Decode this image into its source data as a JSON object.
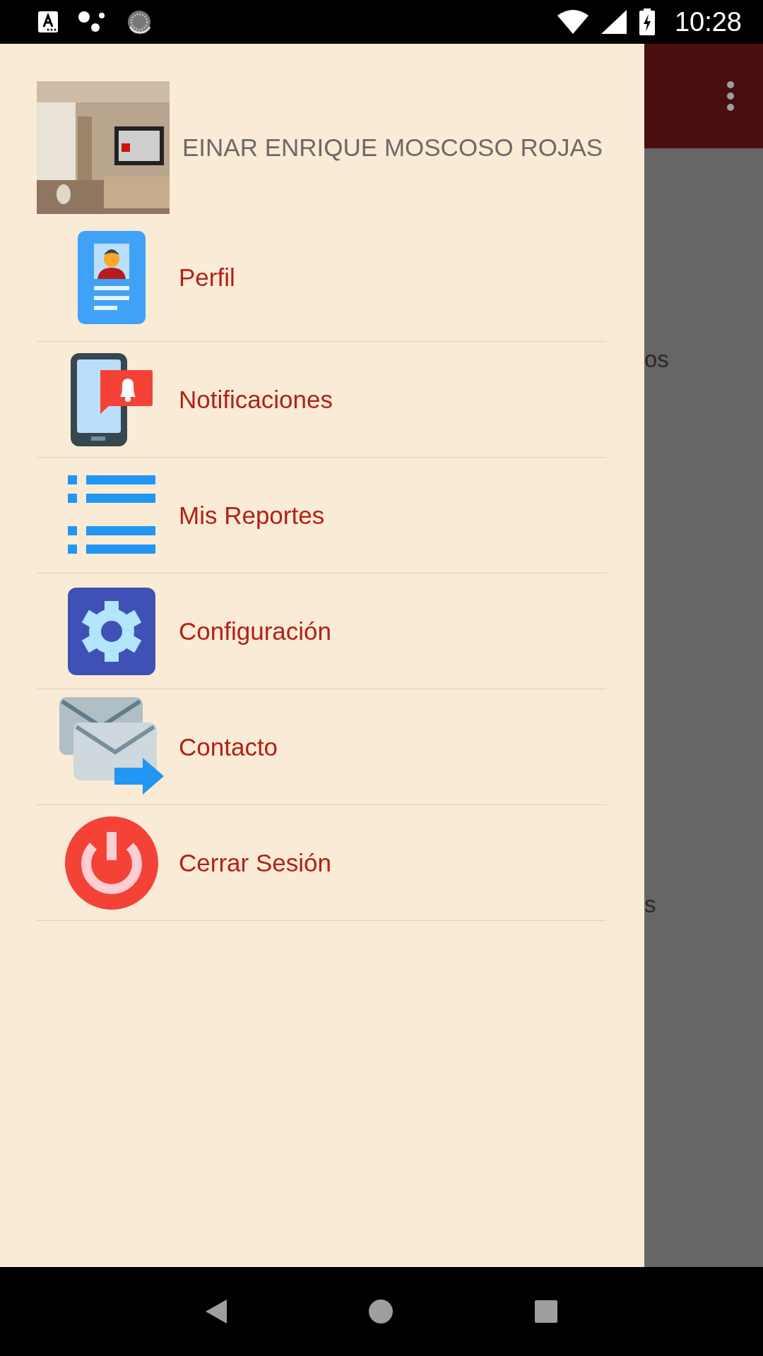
{
  "status_bar": {
    "time": "10:28"
  },
  "drawer": {
    "user_name": "EINAR ENRIQUE MOSCOSO ROJAS",
    "items": [
      {
        "kind": "profile",
        "label": "Perfil"
      },
      {
        "kind": "notifications",
        "label": "Notificaciones"
      },
      {
        "kind": "list",
        "label": "Mis Reportes"
      },
      {
        "kind": "settings",
        "label": "Configuración"
      },
      {
        "kind": "mail",
        "label": "Contacto"
      },
      {
        "kind": "power",
        "label": "Cerrar Sesión"
      }
    ]
  },
  "background": {
    "texts": [
      "os",
      "s"
    ]
  }
}
